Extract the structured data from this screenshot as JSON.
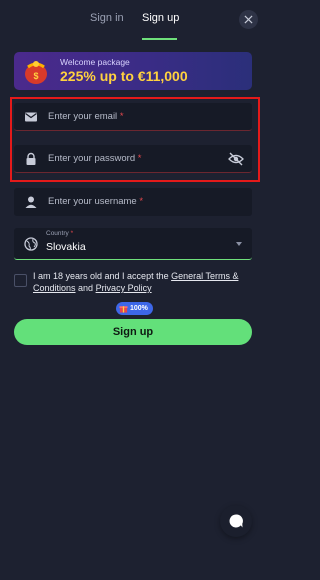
{
  "tabs": {
    "signin_label": "Sign in",
    "signup_label": "Sign up",
    "active": "Sign up"
  },
  "banner": {
    "subtitle": "Welcome package",
    "headline": "225% up to €11,000"
  },
  "fields": {
    "email": {
      "placeholder": "Enter your email",
      "required_mark": "*",
      "icon": "mail-icon"
    },
    "password": {
      "placeholder": "Enter your password",
      "required_mark": "*",
      "icon": "lock-icon",
      "toggle_icon": "eye-off-icon"
    },
    "username": {
      "placeholder": "Enter your username",
      "required_mark": "*",
      "icon": "person-icon"
    }
  },
  "country": {
    "label": "Country",
    "required_mark": "*",
    "value": "Slovakia",
    "icon": "globe-icon"
  },
  "terms": {
    "text_before": "I am 18 years old and I accept the ",
    "link_terms": "General Terms & Conditions",
    "text_mid": " and ",
    "link_privacy": "Privacy Policy"
  },
  "badge": {
    "label": "100%"
  },
  "submit": {
    "label": "Sign up"
  },
  "colors": {
    "background": "#1d2130",
    "accent": "#63e07a",
    "highlight": "#e41a1a",
    "banner_text": "#ffd23f"
  }
}
